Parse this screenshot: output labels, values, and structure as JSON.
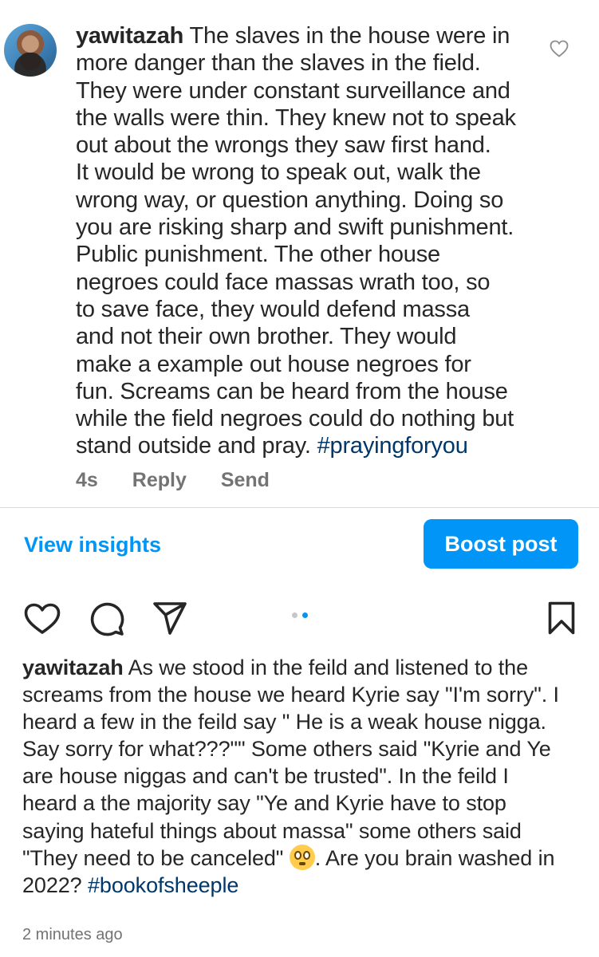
{
  "comment": {
    "username": "yawitazah",
    "text_lines": [
      "The slaves in the house were in",
      "more danger than the slaves in the field.",
      "They were under constant surveillance and",
      "the walls were thin. They knew not to speak",
      "out about the wrongs they saw first hand.",
      "It would be wrong to speak out, walk the",
      "wrong way, or question anything. Doing so",
      "you are risking sharp and swift punishment.",
      "Public punishment. The other house",
      "negroes could face massas wrath too, so",
      "to save face, they would defend massa",
      "and not their own brother. They would",
      "make a example out house negroes for",
      "fun. Screams can be heard from the house",
      "while the field negroes could do nothing but",
      "stand outside and pray."
    ],
    "hashtag": "#prayingforyou",
    "time": "4s",
    "reply_label": "Reply",
    "send_label": "Send"
  },
  "insights": {
    "view_label": "View insights",
    "boost_label": "Boost post"
  },
  "carousel": {
    "total": 2,
    "active_index": 1
  },
  "caption": {
    "username": "yawitazah",
    "lines": [
      "As we stood in the feild and listened to the",
      "screams from the house we heard Kyrie say \"I'm sorry\". I",
      "heard a few in the feild say \" He is a weak house nigga.",
      "Say sorry for what???\"\" Some others said \"Kyrie and Ye",
      "are house niggas and can't be trusted\". In the feild I",
      "heard a the majority say \"Ye and Kyrie have to stop",
      "saying hateful things about massa\" some others said",
      "\"They need to be canceled\""
    ],
    "after_emoji": ". Are you brain washed in",
    "last_line": "2022?",
    "hashtag": "#bookofsheeple",
    "timestamp": "2 minutes ago"
  },
  "colors": {
    "accent": "#0095f6",
    "hashtag": "#00376b",
    "text": "#262626",
    "muted": "#737373"
  }
}
